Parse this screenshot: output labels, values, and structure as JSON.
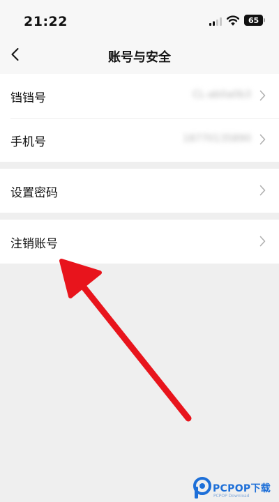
{
  "status_bar": {
    "time": "21:22",
    "battery": "65",
    "icons": [
      "signal-icon",
      "wifi-icon",
      "battery-icon"
    ]
  },
  "nav": {
    "title": "账号与安全",
    "back_icon": "chevron-left-icon"
  },
  "groups": [
    {
      "items": [
        {
          "label": "铛铛号",
          "value": "CL-ab0a0b3",
          "blurred": true
        },
        {
          "label": "手机号",
          "value": "18770135890",
          "blurred": true
        }
      ]
    },
    {
      "items": [
        {
          "label": "设置密码",
          "value": ""
        }
      ]
    },
    {
      "items": [
        {
          "label": "注销账号",
          "value": ""
        }
      ]
    }
  ],
  "annotation": {
    "type": "arrow",
    "color": "#e8141c",
    "target": "注销账号"
  },
  "watermark": {
    "brand": "PCPOP下载",
    "sub": "PCPOP Download"
  },
  "colors": {
    "background": "#efefef",
    "card": "#ffffff",
    "brand_blue": "#1d6fd8",
    "arrow_red": "#e8141c"
  }
}
